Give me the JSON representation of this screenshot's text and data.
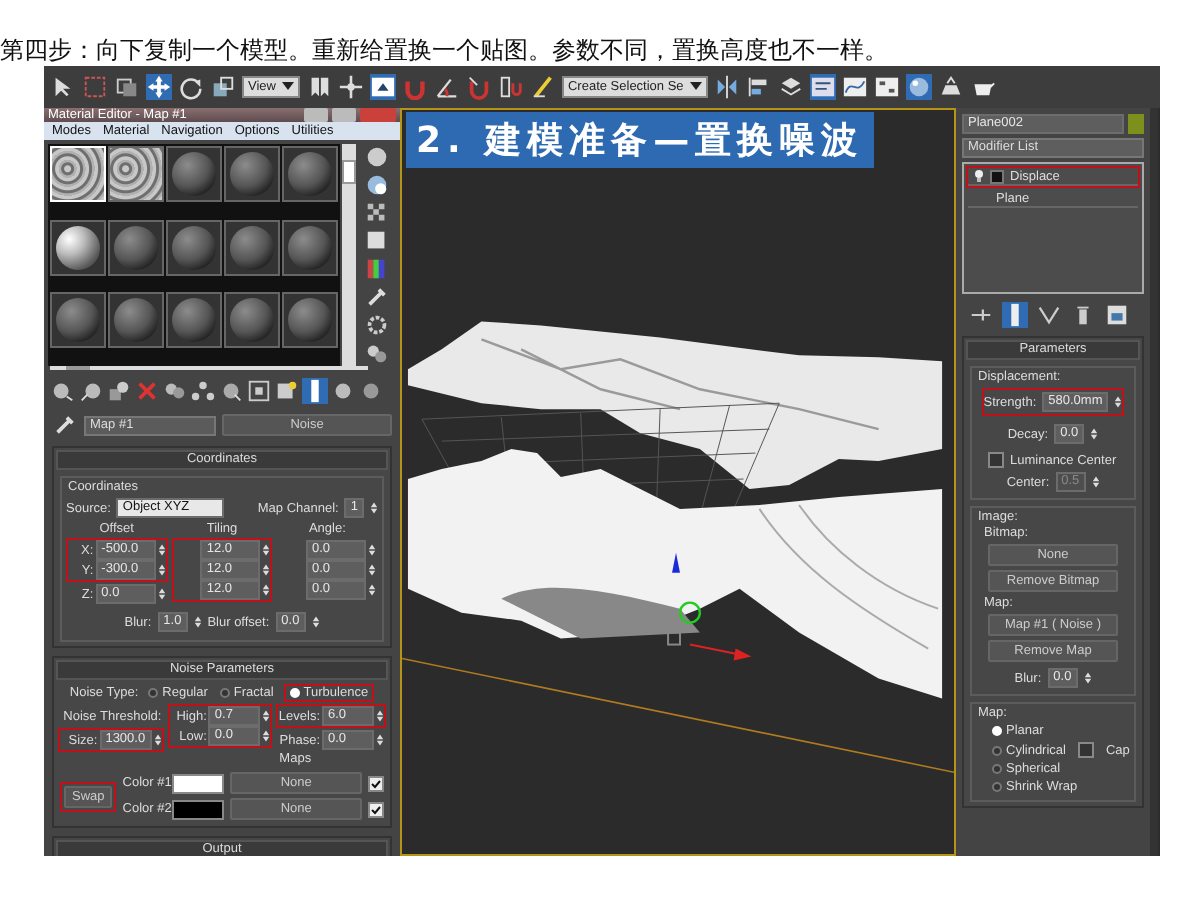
{
  "caption": "第四步：向下复制一个模型。重新给置换一个贴图。参数不同，置换高度也不一样。",
  "toolbar": {
    "view_dropdown": "View",
    "selection_set": "Create Selection Se"
  },
  "material_editor": {
    "title": "Material Editor - Map #1",
    "menu": [
      "Modes",
      "Material",
      "Navigation",
      "Options",
      "Utilities"
    ],
    "slots": [
      {
        "kind": "noise",
        "selected": true
      },
      {
        "kind": "noise",
        "selected": false
      },
      {
        "kind": "sphere",
        "selected": false
      },
      {
        "kind": "sphere",
        "selected": false
      },
      {
        "kind": "sphere",
        "selected": false
      },
      {
        "kind": "lit-sphere",
        "selected": false
      },
      {
        "kind": "sphere",
        "selected": false
      },
      {
        "kind": "sphere",
        "selected": false
      },
      {
        "kind": "sphere",
        "selected": false
      },
      {
        "kind": "sphere",
        "selected": false
      },
      {
        "kind": "sphere",
        "selected": false
      },
      {
        "kind": "sphere",
        "selected": false
      },
      {
        "kind": "sphere",
        "selected": false
      },
      {
        "kind": "sphere",
        "selected": false
      },
      {
        "kind": "sphere",
        "selected": false
      }
    ],
    "map_name": "Map #1",
    "map_type": "Noise",
    "coordinates": {
      "title": "Coordinates",
      "group": "Coordinates",
      "source_label": "Source:",
      "source": "Object XYZ",
      "channel_label": "Map Channel:",
      "channel": "1",
      "columns": [
        {
          "header": "Offset",
          "cells": [
            {
              "label": "X:",
              "value": "-500.0",
              "highlighted": true
            },
            {
              "label": "Y:",
              "value": "-300.0",
              "highlighted": true
            },
            {
              "label": "Z:",
              "value": "0.0",
              "highlighted": false
            }
          ]
        },
        {
          "header": "Tiling",
          "cells": [
            {
              "value": "12.0",
              "highlighted": true
            },
            {
              "value": "12.0",
              "highlighted": true
            },
            {
              "value": "12.0",
              "highlighted": true
            }
          ]
        },
        {
          "header": "Angle:",
          "cells": [
            {
              "value": "0.0",
              "highlighted": false
            },
            {
              "value": "0.0",
              "highlighted": false
            },
            {
              "value": "0.0",
              "highlighted": false
            }
          ]
        }
      ],
      "blur": {
        "label": "Blur:",
        "value": "1.0"
      },
      "blur_offset": {
        "label": "Blur offset:",
        "value": "0.0"
      }
    },
    "noise": {
      "title": "Noise Parameters",
      "type_label": "Noise Type:",
      "types": [
        {
          "label": "Regular",
          "selected": false,
          "highlighted": false
        },
        {
          "label": "Fractal",
          "selected": false,
          "highlighted": false
        },
        {
          "label": "Turbulence",
          "selected": true,
          "highlighted": true
        }
      ],
      "columns": [
        {
          "cells": [
            {
              "label": "Noise Threshold:",
              "highlighted": false
            },
            {
              "label": "Size:",
              "value": "1300.0",
              "highlighted": true
            }
          ]
        },
        {
          "cells": [
            {
              "label": "High:",
              "value": "0.7",
              "highlighted": true
            },
            {
              "label": "Low:",
              "value": "0.0",
              "highlighted": true
            }
          ]
        },
        {
          "cells": [
            {
              "label": "Levels:",
              "value": "6.0",
              "highlighted": true
            },
            {
              "label": "Phase:",
              "value": "0.0",
              "highlighted": false
            }
          ]
        }
      ],
      "maps_header": "Maps",
      "colors": [
        {
          "label": "Color #1",
          "color": "#ffffff",
          "map": "None",
          "checked": true
        },
        {
          "label": "Color #2",
          "color": "#000000",
          "map": "None",
          "checked": true
        }
      ],
      "swap": {
        "label": "Swap",
        "highlighted": true
      }
    },
    "output": {
      "title": "Output"
    }
  },
  "viewport": {
    "banner": "2. 建模准备—置换噪波"
  },
  "command_panel": {
    "object": {
      "name": "Plane002",
      "color": "#7d8f1c"
    },
    "modifier_list": "Modifier List",
    "stack": [
      {
        "label": "Displace",
        "kind": "modifier",
        "highlighted": true
      },
      {
        "label": "Plane",
        "kind": "object",
        "highlighted": false
      }
    ],
    "parameters": {
      "title": "Parameters",
      "displacement_group": "Displacement:",
      "strength": {
        "label": "Strength:",
        "value": "580.0mm",
        "highlighted": true
      },
      "decay": {
        "label": "Decay:",
        "value": "0.0",
        "highlighted": false
      },
      "luminance_center": {
        "label": "Luminance Center",
        "checked": false
      },
      "center": {
        "label": "Center:",
        "value": "0.5",
        "disabled": true
      },
      "image_group": "Image:",
      "bitmap_label": "Bitmap:",
      "bitmap_button": "None",
      "remove_bitmap": "Remove Bitmap",
      "map_label": "Map:",
      "map_button": "Map #1 ( Noise )",
      "remove_map": "Remove Map",
      "blur": {
        "label": "Blur:",
        "value": "0.0"
      },
      "map_group": "Map:",
      "mappings": [
        {
          "label": "Planar",
          "selected": true
        },
        {
          "label": "Cylindrical",
          "selected": false,
          "option": {
            "label": "Cap",
            "checked": false
          }
        },
        {
          "label": "Spherical",
          "selected": false
        },
        {
          "label": "Shrink Wrap",
          "selected": false
        }
      ]
    }
  }
}
